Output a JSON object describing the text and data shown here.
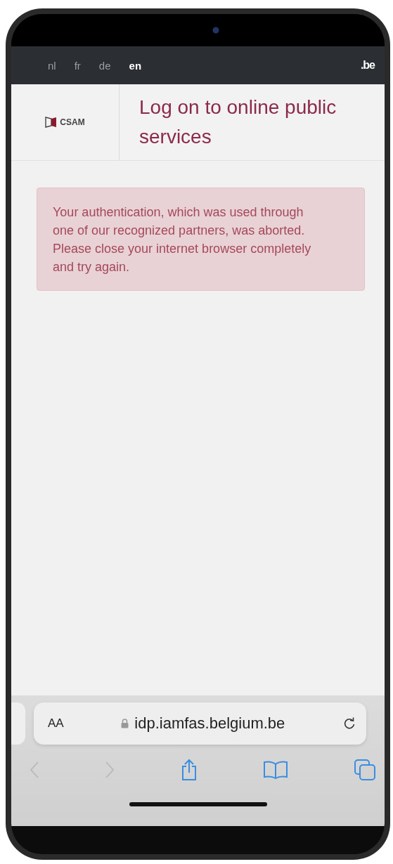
{
  "languages": [
    {
      "label": "nl",
      "selected": false
    },
    {
      "label": "fr",
      "selected": false
    },
    {
      "label": "de",
      "selected": false
    },
    {
      "label": "en",
      "selected": true
    }
  ],
  "brand": ".be",
  "header": {
    "logo_text": "CSAM",
    "title": "Log on to online public services"
  },
  "alert": {
    "message": "Your authentication, which was used through one of our recognized partners, was aborted. Please close your internet browser completely and try again."
  },
  "browser": {
    "text_size_label": "AA",
    "url": "idp.iamfas.belgium.be",
    "toolbar": [
      {
        "kind": "back",
        "disabled": true
      },
      {
        "kind": "forward",
        "disabled": true
      },
      {
        "kind": "share",
        "disabled": false
      },
      {
        "kind": "bookmarks",
        "disabled": false
      },
      {
        "kind": "tabs",
        "disabled": false
      }
    ]
  }
}
